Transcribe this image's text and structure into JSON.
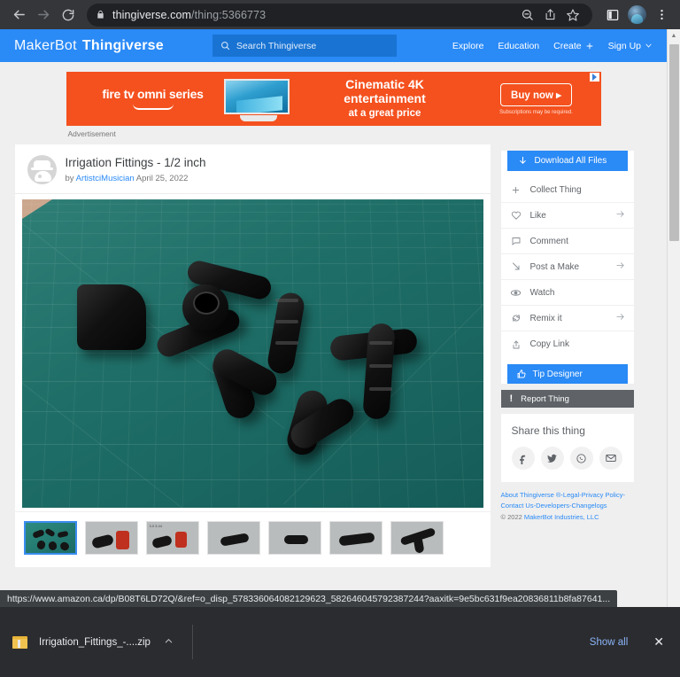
{
  "browser": {
    "back_icon": "back-arrow-icon",
    "forward_icon": "forward-arrow-icon",
    "reload_icon": "reload-icon",
    "lock_icon": "lock-icon",
    "url_domain": "thingiverse.com",
    "url_path": "/thing:5366773",
    "omnibox_zoom_icon": "zoom-out-icon",
    "omnibox_share_icon": "share-icon",
    "omnibox_bookmark_icon": "star-icon",
    "split_screen_icon": "split-screen-icon",
    "profile_icon": "profile-avatar",
    "menu_icon": "three-dot-menu-icon"
  },
  "site_header": {
    "brand_first": "MakerBot",
    "brand_second": "Thingiverse",
    "search_placeholder": "Search Thingiverse",
    "search_icon": "search-icon",
    "nav": [
      {
        "label": "Explore",
        "icon": null
      },
      {
        "label": "Education",
        "icon": null
      },
      {
        "label": "Create",
        "icon": "plus-icon"
      },
      {
        "label": "Sign Up",
        "icon": "chevron-down-icon"
      }
    ]
  },
  "ad": {
    "brand": "fire tv omni series",
    "headline_1": "Cinematic 4K",
    "headline_2": "entertainment",
    "headline_3": "at a great price",
    "cta": "Buy now",
    "disclaimer": "Subscriptions may be required.",
    "label": "Advertisement",
    "adchoices_icon": "adchoices-icon",
    "accent": "#f4511e"
  },
  "thing": {
    "title": "Irrigation Fittings - 1/2 inch",
    "by_prefix": "by",
    "author": "ArtistciMusician",
    "date": "April 25, 2022",
    "avatar_icon": "user-avatar-icon",
    "hero_alt": "irrigation-fittings-photo",
    "thumbnails": [
      {
        "name": "thumb-1-photo-mat",
        "selected": true
      },
      {
        "name": "thumb-2-render-red",
        "selected": false
      },
      {
        "name": "thumb-3-render-dimensions",
        "selected": false
      },
      {
        "name": "thumb-4-render-elbow",
        "selected": false
      },
      {
        "name": "thumb-5-render-coupler",
        "selected": false
      },
      {
        "name": "thumb-6-render-barb",
        "selected": false
      },
      {
        "name": "thumb-7-render-tee",
        "selected": false
      }
    ]
  },
  "sidebar": {
    "download_all_label": "Download All Files",
    "download_icon": "download-arrow-icon",
    "items": [
      {
        "label": "Collect Thing",
        "icon": "plus-icon",
        "arrow": false
      },
      {
        "label": "Like",
        "icon": "heart-icon",
        "arrow": true
      },
      {
        "label": "Comment",
        "icon": "comment-icon",
        "arrow": false
      },
      {
        "label": "Post a Make",
        "icon": "camera-make-icon",
        "arrow": true
      },
      {
        "label": "Watch",
        "icon": "eye-icon",
        "arrow": false
      },
      {
        "label": "Remix it",
        "icon": "remix-refresh-icon",
        "arrow": true
      },
      {
        "label": "Copy Link",
        "icon": "copy-link-icon",
        "arrow": false
      }
    ],
    "tip_designer_label": "Tip Designer",
    "tip_icon": "thumbs-up-icon",
    "report_label": "Report Thing",
    "report_icon": "exclamation-icon",
    "share_title": "Share this thing",
    "share_buttons": [
      {
        "name": "facebook-icon",
        "glyph": "f"
      },
      {
        "name": "twitter-icon",
        "glyph": "t"
      },
      {
        "name": "whatsapp-icon",
        "glyph": "w"
      },
      {
        "name": "email-icon",
        "glyph": "m"
      }
    ],
    "accent": "#2a8af6"
  },
  "footer": {
    "line1": "About Thingiverse ®-Legal-Privacy Policy-",
    "line2": "Contact Us-Developers-Changelogs",
    "copyright": "© 2022 ",
    "company": "MakerBot Industries, LLC"
  },
  "status": {
    "url": "https://www.amazon.ca/dp/B08T6LD72Q/&ref=o_disp_578336064082129623_582646045792387244?aaxitk=9e5bc631f9ea20836811b8fa87641..."
  },
  "downloads": {
    "file_name": "Irrigation_Fittings_-....zip",
    "file_icon": "zip-file-icon",
    "caret_icon": "chevron-up-icon",
    "show_all": "Show all",
    "close_icon": "close-icon"
  }
}
